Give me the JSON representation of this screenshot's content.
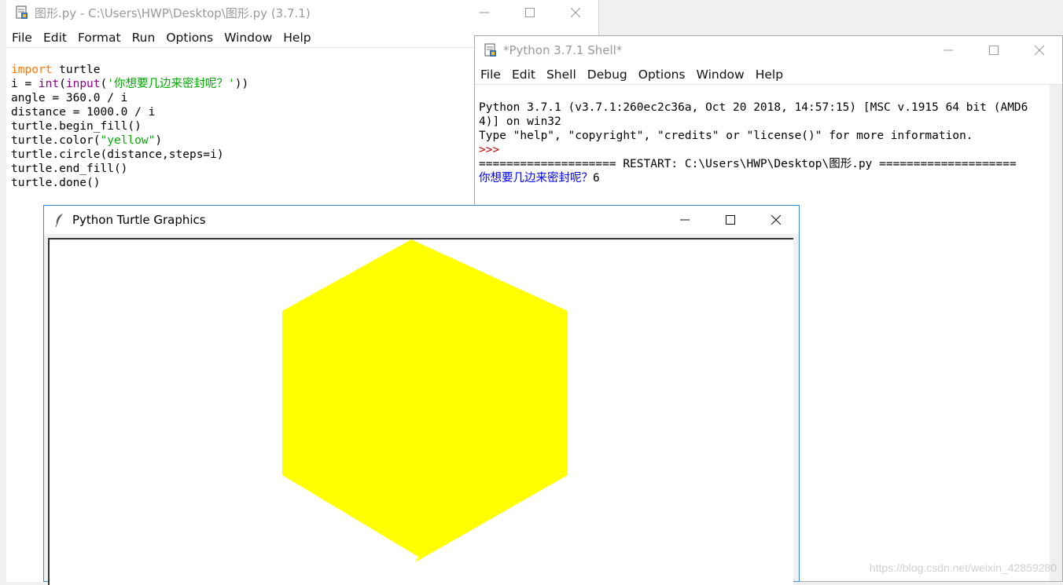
{
  "editor": {
    "title": "图形.py - C:\\Users\\HWP\\Desktop\\图形.py (3.7.1)",
    "menu": [
      "File",
      "Edit",
      "Format",
      "Run",
      "Options",
      "Window",
      "Help"
    ],
    "code": {
      "l1_kw": "import",
      "l1_rest": " turtle",
      "l2_a": "i = ",
      "l2_int": "int",
      "l2_b": "(",
      "l2_input": "input",
      "l2_c": "(",
      "l2_str": "'你想要几边来密封呢？'",
      "l2_d": "))",
      "l3": "angle = 360.0 / i",
      "l4": "distance = 1000.0 / i",
      "l5": "turtle.begin_fill()",
      "l6_a": "turtle.color(",
      "l6_str": "\"yellow\"",
      "l6_b": ")",
      "l7": "turtle.circle(distance,steps=i)",
      "l8": "turtle.end_fill()",
      "l9": "turtle.done()"
    }
  },
  "shell": {
    "title": "*Python 3.7.1 Shell*",
    "menu": [
      "File",
      "Edit",
      "Shell",
      "Debug",
      "Options",
      "Window",
      "Help"
    ],
    "lines": {
      "l1": "Python 3.7.1 (v3.7.1:260ec2c36a, Oct 20 2018, 14:57:15) [MSC v.1915 64 bit (AMD6",
      "l2": "4)] on win32",
      "l3": "Type \"help\", \"copyright\", \"credits\" or \"license()\" for more information.",
      "prompt": ">>>",
      "restart": "==================== RESTART: C:\\Users\\HWP\\Desktop\\图形.py ====================",
      "question": "你想要几边来密封呢？",
      "answer": "6"
    }
  },
  "turtle": {
    "title": "Python Turtle Graphics",
    "fill_color": "#ffff00",
    "sides": 6
  },
  "watermark": "https://blog.csdn.net/weixin_42859280",
  "icons": {
    "idle": "idle-file-icon",
    "feather": "feather-icon",
    "minimize": "minimize-icon",
    "maximize": "maximize-icon",
    "close": "close-icon"
  }
}
